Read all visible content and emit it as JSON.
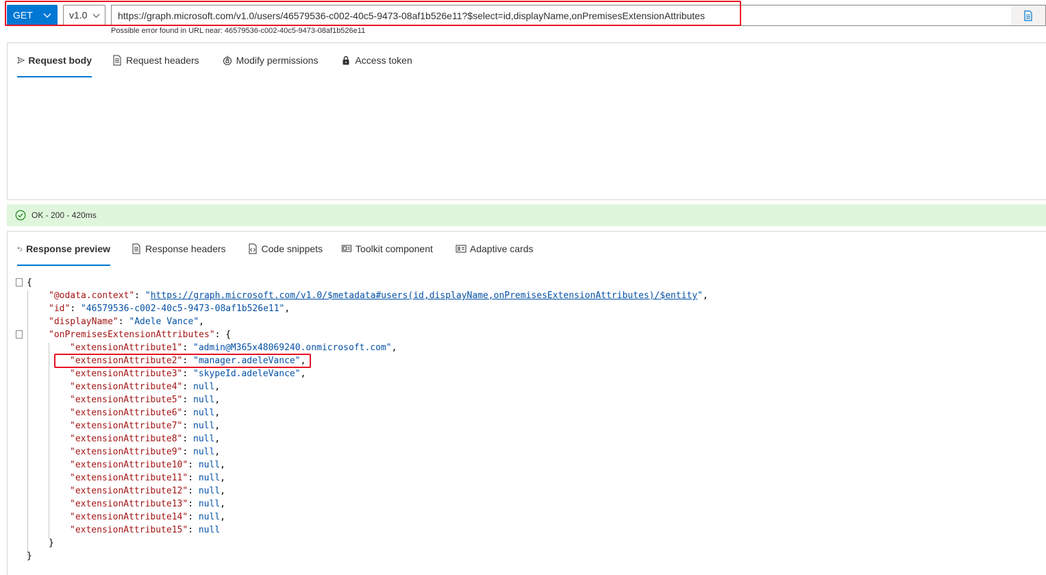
{
  "request": {
    "method": "GET",
    "version": "v1.0",
    "url": "https://graph.microsoft.com/v1.0/users/46579536-c002-40c5-9473-08af1b526e11?$select=id,displayName,onPremisesExtensionAttributes",
    "error_hint": "Possible error found in URL near: 46579536-c002-40c5-9473-08af1b526e11"
  },
  "request_tabs": [
    {
      "label": "Request body",
      "icon": "send-icon",
      "active": true
    },
    {
      "label": "Request headers",
      "icon": "document-list-icon",
      "active": false
    },
    {
      "label": "Modify permissions",
      "icon": "shield-lock-icon",
      "active": false
    },
    {
      "label": "Access token",
      "icon": "lock-icon",
      "active": false
    }
  ],
  "status": {
    "text": "OK - 200 - 420ms",
    "icon": "check-circle-icon",
    "color": "#dff6dd"
  },
  "response_tabs": [
    {
      "label": "Response preview",
      "icon": "undo-arrow-icon",
      "active": true
    },
    {
      "label": "Response headers",
      "icon": "document-list-icon",
      "active": false
    },
    {
      "label": "Code snippets",
      "icon": "code-file-icon",
      "active": false
    },
    {
      "label": "Toolkit component",
      "icon": "component-icon",
      "active": false
    },
    {
      "label": "Adaptive cards",
      "icon": "card-icon",
      "active": false
    }
  ],
  "response": {
    "odata_context_key": "\"@odata.context\"",
    "odata_context_value": "https://graph.microsoft.com/v1.0/$metadata#users(id,displayName,onPremisesExtensionAttributes)/$entity",
    "id_key": "\"id\"",
    "id_value": "\"46579536-c002-40c5-9473-08af1b526e11\"",
    "displayName_key": "\"displayName\"",
    "displayName_value": "\"Adele Vance\"",
    "ext_key": "\"onPremisesExtensionAttributes\"",
    "attributes": [
      {
        "key": "\"extensionAttribute1\"",
        "value": "\"admin@M365x48069240.onmicrosoft.com\"",
        "type": "string",
        "sep": ","
      },
      {
        "key": "\"extensionAttribute2\"",
        "value": "\"manager.adeleVance\"",
        "type": "string",
        "sep": ","
      },
      {
        "key": "\"extensionAttribute3\"",
        "value": "\"skypeId.adeleVance\"",
        "type": "string",
        "sep": ","
      },
      {
        "key": "\"extensionAttribute4\"",
        "value": "null",
        "type": "null",
        "sep": ","
      },
      {
        "key": "\"extensionAttribute5\"",
        "value": "null",
        "type": "null",
        "sep": ","
      },
      {
        "key": "\"extensionAttribute6\"",
        "value": "null",
        "type": "null",
        "sep": ","
      },
      {
        "key": "\"extensionAttribute7\"",
        "value": "null",
        "type": "null",
        "sep": ","
      },
      {
        "key": "\"extensionAttribute8\"",
        "value": "null",
        "type": "null",
        "sep": ","
      },
      {
        "key": "\"extensionAttribute9\"",
        "value": "null",
        "type": "null",
        "sep": ","
      },
      {
        "key": "\"extensionAttribute10\"",
        "value": "null",
        "type": "null",
        "sep": ","
      },
      {
        "key": "\"extensionAttribute11\"",
        "value": "null",
        "type": "null",
        "sep": ","
      },
      {
        "key": "\"extensionAttribute12\"",
        "value": "null",
        "type": "null",
        "sep": ","
      },
      {
        "key": "\"extensionAttribute13\"",
        "value": "null",
        "type": "null",
        "sep": ","
      },
      {
        "key": "\"extensionAttribute14\"",
        "value": "null",
        "type": "null",
        "sep": ","
      },
      {
        "key": "\"extensionAttribute15\"",
        "value": "null",
        "type": "null",
        "sep": ""
      }
    ]
  },
  "colors": {
    "accent": "#0078d4",
    "highlight": "#e81123",
    "json_key": "#a31515",
    "json_value": "#0451a5"
  }
}
